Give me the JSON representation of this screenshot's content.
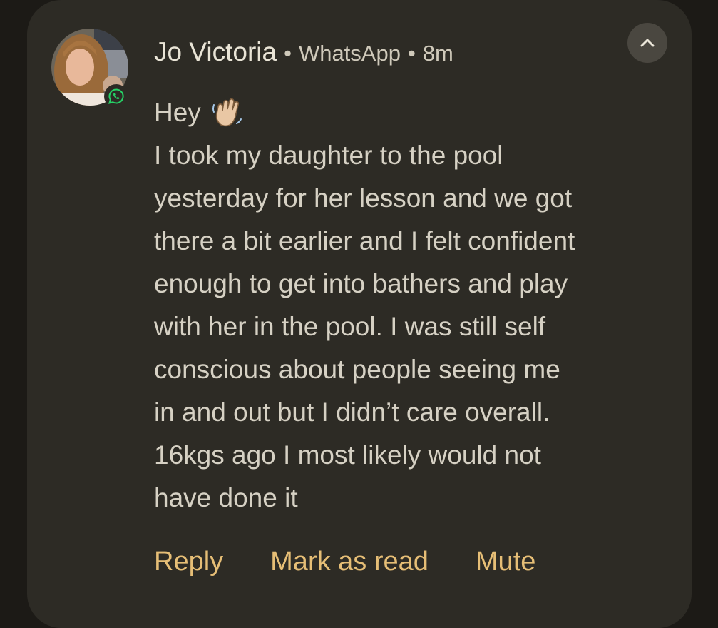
{
  "notification": {
    "sender": "Jo Victoria",
    "app": "WhatsApp",
    "time": "8m",
    "separator": "•",
    "greeting": "Hey",
    "greeting_emoji": "waving-hand-emoji",
    "message_lines": [
      "I took my daughter to the pool",
      "yesterday for her lesson and we got",
      "there a bit earlier and I felt confident",
      "enough to get into bathers and play",
      "with her in the pool. I was still self",
      "conscious about people seeing me",
      "in and out but I didn’t care overall.",
      "16kgs ago I most likely would not",
      "have done it"
    ],
    "icons": {
      "avatar": "contact-avatar",
      "app_badge": "whatsapp-icon",
      "collapse": "chevron-up-icon"
    }
  },
  "actions": {
    "reply": "Reply",
    "mark_read": "Mark as read",
    "mute": "Mute"
  },
  "colors": {
    "card_bg": "#2d2b25",
    "page_bg": "#1c1a16",
    "action_accent": "#e6be76",
    "whatsapp_green": "#25d366"
  }
}
